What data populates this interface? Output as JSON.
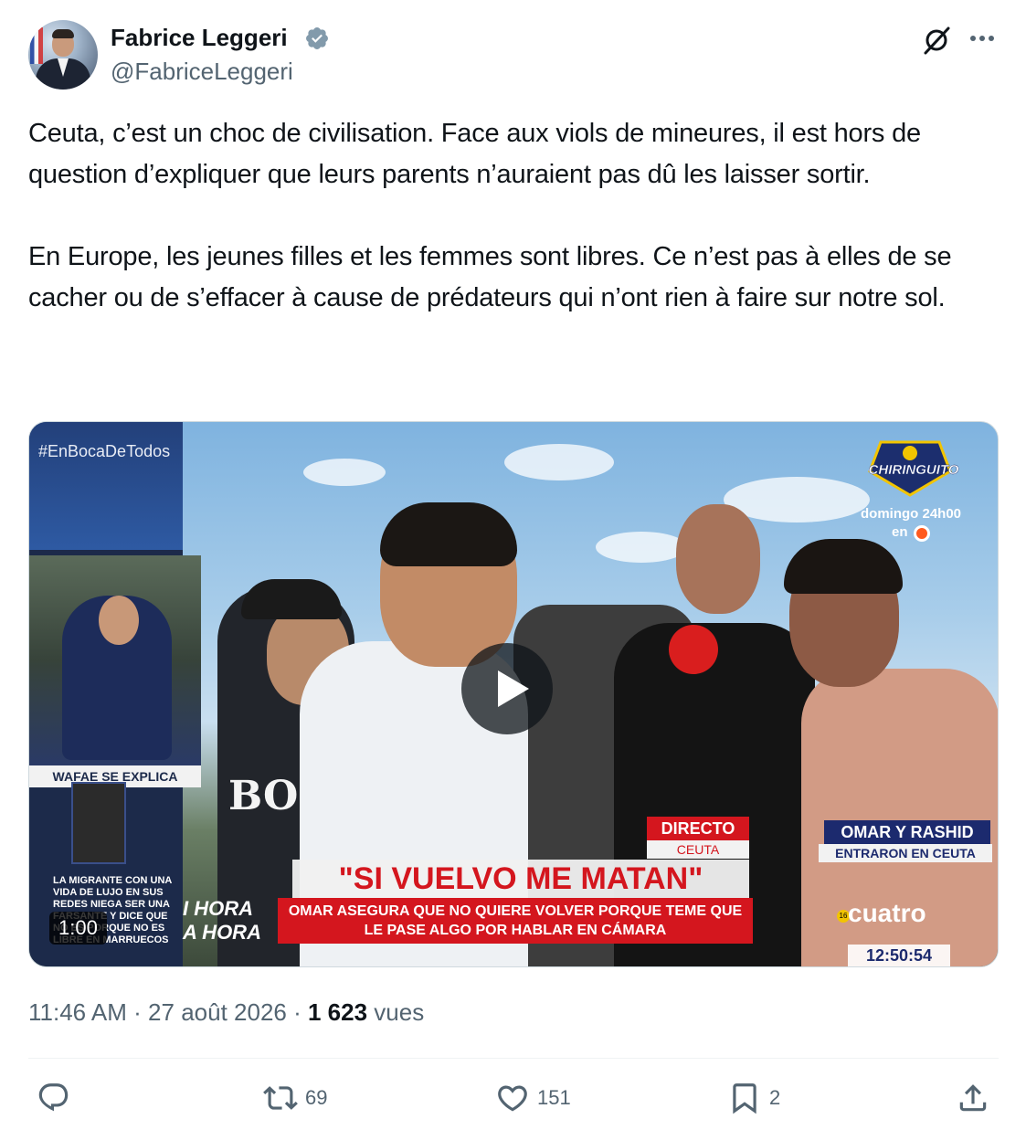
{
  "author": {
    "name": "Fabrice Leggeri",
    "handle": "@FabriceLeggeri",
    "verified": true,
    "verified_color": "#829aab"
  },
  "header_icons": [
    "grok-icon",
    "more-icon"
  ],
  "tweet": {
    "paragraph1": "Ceuta, c’est un choc de civilisation. Face aux viols de mineures, il est hors de question d’expliquer que leurs parents n’auraient pas dû les laisser sortir.",
    "paragraph2": "En Europe, les jeunes filles et les femmes sont libres. Ce n’est pas à elles de se cacher ou de s’effacer à cause de prédateurs qui n’ont rien à faire sur notre sol."
  },
  "video": {
    "duration": "1:00",
    "overlay": {
      "hashtag": "#EnBocaDeTodos",
      "inset_label": "WAFAE SE EXPLICA",
      "inset_caption": "LA MIGRANTE CON UNA VIDA DE LUJO EN SUS REDES NIEGA SER UNA FARSANTE Y DICE QUE NO ES PORQUE NO ES LIBRE EN MARRUECOS",
      "hora_line1": "I HORA",
      "hora_line2": "A HORA",
      "shirt_text": "BOS",
      "logo": "CHIRINGUITO",
      "schedule": "domingo 24h00",
      "schedule_en": "en",
      "directo": "DIRECTO",
      "location": "CEUTA",
      "names": "OMAR Y RASHID",
      "names_sub": "ENTRARON EN CEUTA",
      "headline": "\"SI VUELVO ME MATAN\"",
      "subline": "OMAR ASEGURA QUE NO QUIERE VOLVER PORQUE TEME QUE LE PASE ALGO POR HABLAR EN CÁMARA",
      "channel": "cuatro",
      "rating": "16",
      "clock": "12:50:54"
    }
  },
  "meta": {
    "time": "11:46 AM",
    "sep": " · ",
    "date": "27 août 2026",
    "views_count": "1 623",
    "views_label": " vues"
  },
  "actions": {
    "reply_count": "",
    "retweet_count": "69",
    "like_count": "151",
    "bookmark_count": "2"
  }
}
